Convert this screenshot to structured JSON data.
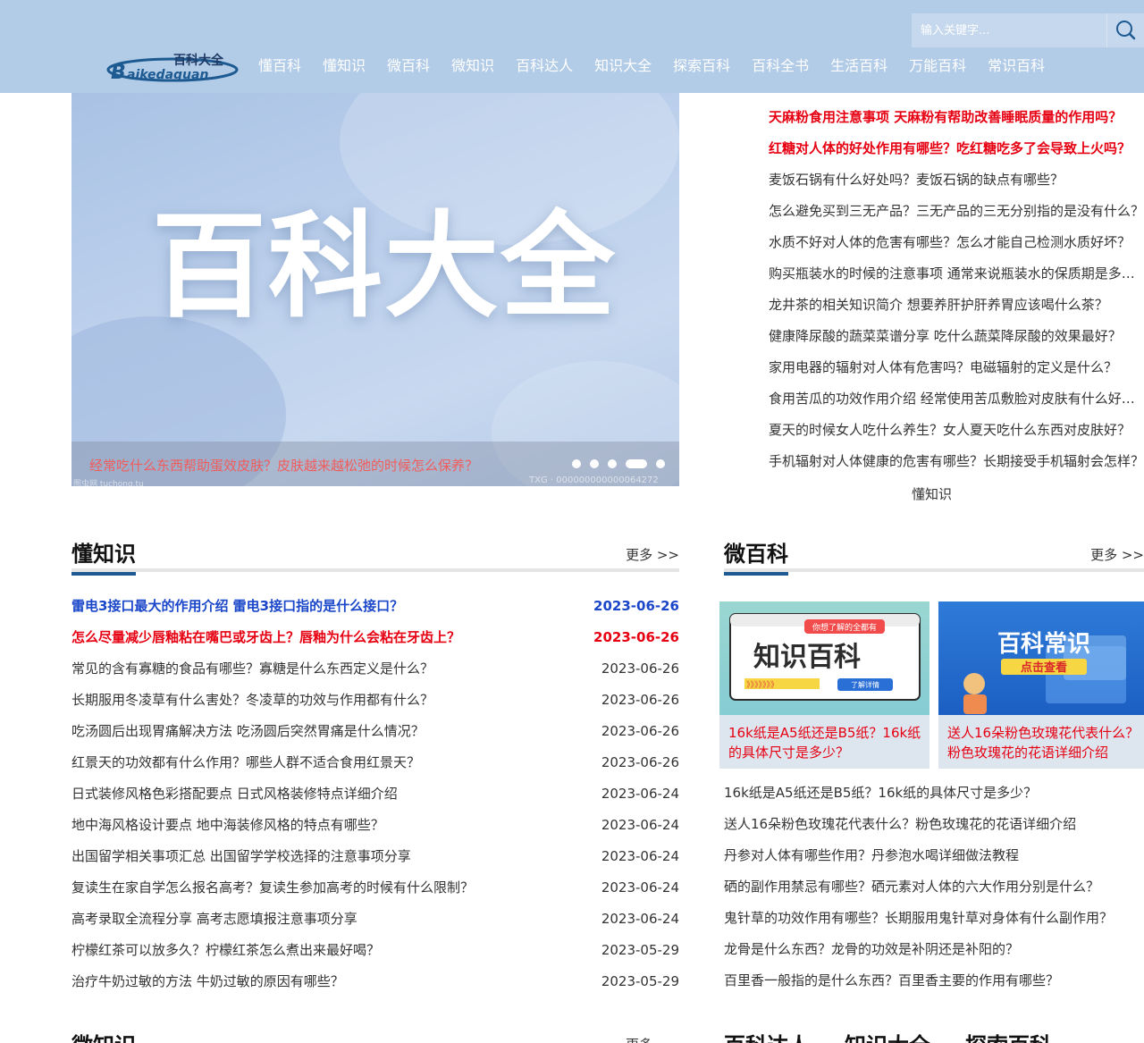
{
  "header": {
    "logo_text": "百科大全",
    "logo_sub": "Baikedaquan",
    "nav": [
      "懂百科",
      "懂知识",
      "微百科",
      "微知识",
      "百科达人",
      "知识大全",
      "探索百科",
      "百科全书",
      "生活百科",
      "万能百科",
      "常识百科"
    ],
    "search_placeholder": "输入关键字...",
    "colors": {
      "bar": "#b2cbe6",
      "search": "#c6d8ee"
    }
  },
  "banner": {
    "title": "百科大全",
    "caption": "经常吃什么东西帮助蛋效皮肤？皮肤越来越松弛的时候怎么保养？",
    "watermark_left": "图虫网 tuchong.tu",
    "watermark": "TXG · 000000000000064272",
    "active_dot": 4,
    "dot_count": 5
  },
  "top_list": {
    "items": [
      "天麻粉食用注意事项 天麻粉有帮助改善睡眠质量的作用吗？",
      "红糖对人体的好处作用有哪些？吃红糖吃多了会导致上火吗？",
      "麦饭石锅有什么好处吗？麦饭石锅的缺点有哪些？",
      "怎么避免买到三无产品？三无产品的三无分别指的是没有什么？",
      "水质不好对人体的危害有哪些？怎么才能自己检测水质好坏？",
      "购买瓶装水的时候的注意事项 通常来说瓶装水的保质期是多久？",
      "龙井茶的相关知识简介 想要养肝护肝养胃应该喝什么茶？",
      "健康降尿酸的蔬菜菜谱分享 吃什么蔬菜降尿酸的效果最好？",
      "家用电器的辐射对人体有危害吗？电磁辐射的定义是什么？",
      "食用苦瓜的功效作用介绍 经常使用苦瓜敷脸对皮肤有什么好处？",
      "夏天的时候女人吃什么养生？女人夏天吃什么东西对皮肤好？",
      "手机辐射对人体健康的危害有哪些？长期接受手机辐射会怎样？"
    ],
    "hot_count": 2,
    "footer": "懂知识"
  },
  "dzs": {
    "title": "懂知识",
    "more": "更多 >>",
    "rows": [
      {
        "title": "雷电3接口最大的作用介绍 雷电3接口指的是什么接口？",
        "date": "2023-06-26",
        "style": "blue"
      },
      {
        "title": "怎么尽量减少唇釉粘在嘴巴或牙齿上？唇釉为什么会粘在牙齿上？",
        "date": "2023-06-26",
        "style": "red"
      },
      {
        "title": "常见的含有寡糖的食品有哪些？寡糖是什么东西定义是什么？",
        "date": "2023-06-26",
        "style": ""
      },
      {
        "title": "长期服用冬凌草有什么害处？冬凌草的功效与作用都有什么？",
        "date": "2023-06-26",
        "style": ""
      },
      {
        "title": "吃汤圆后出现胃痛解决方法 吃汤圆后突然胃痛是什么情况？",
        "date": "2023-06-26",
        "style": ""
      },
      {
        "title": "红景天的功效都有什么作用？哪些人群不适合食用红景天？",
        "date": "2023-06-26",
        "style": ""
      },
      {
        "title": "日式装修风格色彩搭配要点 日式风格装修特点详细介绍",
        "date": "2023-06-24",
        "style": ""
      },
      {
        "title": "地中海风格设计要点 地中海装修风格的特点有哪些？",
        "date": "2023-06-24",
        "style": ""
      },
      {
        "title": "出国留学相关事项汇总 出国留学学校选择的注意事项分享",
        "date": "2023-06-24",
        "style": ""
      },
      {
        "title": "复读生在家自学怎么报名高考？复读生参加高考的时候有什么限制？",
        "date": "2023-06-24",
        "style": ""
      },
      {
        "title": "高考录取全流程分享 高考志愿填报注意事项分享",
        "date": "2023-06-24",
        "style": ""
      },
      {
        "title": "柠檬红茶可以放多久？柠檬红茶怎么煮出来最好喝？",
        "date": "2023-05-29",
        "style": ""
      },
      {
        "title": "治疗牛奶过敏的方法 牛奶过敏的原因有哪些？",
        "date": "2023-05-29",
        "style": ""
      }
    ]
  },
  "wbk": {
    "title": "微百科",
    "more": "更多 >>",
    "cards": [
      {
        "caption": "16k纸是A5纸还是B5纸？16k纸的具体尺寸是多少？",
        "img_top": "你想了解的全都有",
        "img_main": "知识百科",
        "img_link": "了解详情",
        "img_arrows": "》》》》》》》"
      },
      {
        "caption": "送人16朵粉色玫瑰花代表什么？粉色玫瑰花的花语详细介绍",
        "img_main": "百科常识",
        "img_sub": "点击查看"
      }
    ],
    "list": [
      "16k纸是A5纸还是B5纸？16k纸的具体尺寸是多少？",
      "送人16朵粉色玫瑰花代表什么？粉色玫瑰花的花语详细介绍",
      "丹参对人体有哪些作用？丹参泡水喝详细做法教程",
      "硒的副作用禁忌有哪些？硒元素对人体的六大作用分别是什么？",
      "鬼针草的功效作用有哪些？长期服用鬼针草对身体有什么副作用？",
      "龙骨是什么东西？龙骨的功效是补阴还是补阳的？",
      "百里香一般指的是什么东西？百里香主要的作用有哪些？"
    ]
  },
  "bottom": {
    "left_title": "微知识",
    "left_more": "更多",
    "right_titles": [
      "百科达人",
      "知识大全",
      "探索百科"
    ]
  }
}
